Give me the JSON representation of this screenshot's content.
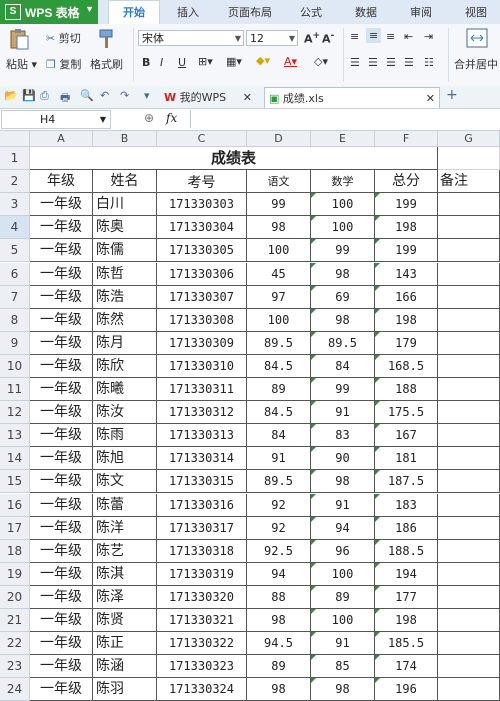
{
  "app": {
    "name": "WPS 表格",
    "logo": "S"
  },
  "ribbon_tabs": [
    "开始",
    "插入",
    "页面布局",
    "公式",
    "数据",
    "审阅",
    "视图"
  ],
  "active_tab": 0,
  "ribbon": {
    "paste": "粘贴",
    "cut": "剪切",
    "copy": "复制",
    "format_painter": "格式刷",
    "font_name": "宋体",
    "font_size": "12",
    "merge_center": "合并居中"
  },
  "doc_tabs": [
    {
      "label": "我的WPS"
    },
    {
      "label": "成绩.xls"
    }
  ],
  "formula_bar": {
    "name_box": "H4",
    "fx": "fx"
  },
  "columns": [
    "A",
    "B",
    "C",
    "D",
    "E",
    "F",
    "G"
  ],
  "rows": [
    "1",
    "2",
    "3",
    "4",
    "5",
    "6",
    "7",
    "8",
    "9",
    "10",
    "11",
    "12",
    "13",
    "14",
    "15",
    "16",
    "17",
    "18",
    "19",
    "20",
    "21",
    "22",
    "23",
    "24"
  ],
  "sheet": {
    "title": "成绩表",
    "headers": [
      "年级",
      "姓名",
      "考号",
      "语文",
      "数学",
      "总分",
      "备注"
    ],
    "records": [
      [
        "一年级",
        "白川",
        "171330303",
        "99",
        "100",
        "199"
      ],
      [
        "一年级",
        "陈奥",
        "171330304",
        "98",
        "100",
        "198"
      ],
      [
        "一年级",
        "陈儒",
        "171330305",
        "100",
        "99",
        "199"
      ],
      [
        "一年级",
        "陈哲",
        "171330306",
        "45",
        "98",
        "143"
      ],
      [
        "一年级",
        "陈浩",
        "171330307",
        "97",
        "69",
        "166"
      ],
      [
        "一年级",
        "陈然",
        "171330308",
        "100",
        "98",
        "198"
      ],
      [
        "一年级",
        "陈月",
        "171330309",
        "89.5",
        "89.5",
        "179"
      ],
      [
        "一年级",
        "陈欣",
        "171330310",
        "84.5",
        "84",
        "168.5"
      ],
      [
        "一年级",
        "陈曦",
        "171330311",
        "89",
        "99",
        "188"
      ],
      [
        "一年级",
        "陈汝",
        "171330312",
        "84.5",
        "91",
        "175.5"
      ],
      [
        "一年级",
        "陈雨",
        "171330313",
        "84",
        "83",
        "167"
      ],
      [
        "一年级",
        "陈旭",
        "171330314",
        "91",
        "90",
        "181"
      ],
      [
        "一年级",
        "陈文",
        "171330315",
        "89.5",
        "98",
        "187.5"
      ],
      [
        "一年级",
        "陈蕾",
        "171330316",
        "92",
        "91",
        "183"
      ],
      [
        "一年级",
        "陈洋",
        "171330317",
        "92",
        "94",
        "186"
      ],
      [
        "一年级",
        "陈艺",
        "171330318",
        "92.5",
        "96",
        "188.5"
      ],
      [
        "一年级",
        "陈淇",
        "171330319",
        "94",
        "100",
        "194"
      ],
      [
        "一年级",
        "陈泽",
        "171330320",
        "88",
        "89",
        "177"
      ],
      [
        "一年级",
        "陈贤",
        "171330321",
        "98",
        "100",
        "198"
      ],
      [
        "一年级",
        "陈正",
        "171330322",
        "94.5",
        "91",
        "185.5"
      ],
      [
        "一年级",
        "陈涵",
        "171330323",
        "89",
        "85",
        "174"
      ],
      [
        "一年级",
        "陈羽",
        "171330324",
        "98",
        "98",
        "196"
      ]
    ]
  },
  "selected_cell": "H4",
  "colors": {
    "accent_green": "#2f9a3c",
    "active_tab_text": "#2e7ec1"
  }
}
